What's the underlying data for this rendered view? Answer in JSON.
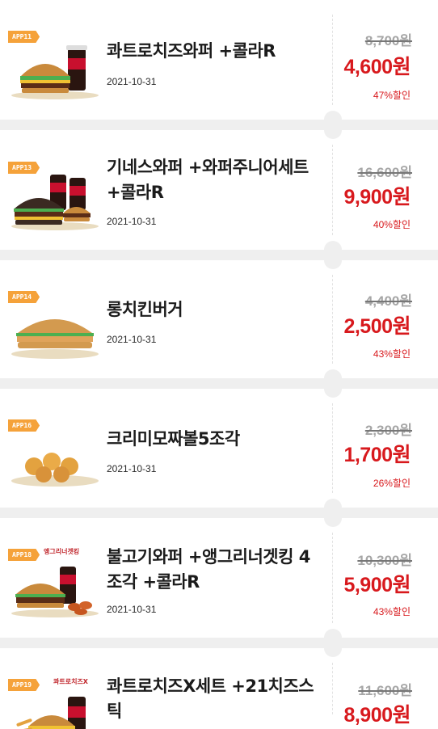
{
  "coupons": [
    {
      "badge": "APP11",
      "badge_tag": "",
      "title": "콰트로치즈와퍼 +콜라R",
      "date": "2021-10-31",
      "original_price": "8,700원",
      "price": "4,600원",
      "discount": "47%할인",
      "image": "burger-set-with-cola"
    },
    {
      "badge": "APP13",
      "badge_tag": "",
      "title": "기네스와퍼 +와퍼주니어세트 +콜라R",
      "date": "2021-10-31",
      "original_price": "16,600원",
      "price": "9,900원",
      "discount": "40%할인",
      "image": "double-burger-set"
    },
    {
      "badge": "APP14",
      "badge_tag": "",
      "title": "롱치킨버거",
      "date": "2021-10-31",
      "original_price": "4,400원",
      "price": "2,500원",
      "discount": "43%할인",
      "image": "long-chicken-burger"
    },
    {
      "badge": "APP16",
      "badge_tag": "",
      "title": "크리미모짜볼5조각",
      "date": "2021-10-31",
      "original_price": "2,300원",
      "price": "1,700원",
      "discount": "26%할인",
      "image": "mozza-balls"
    },
    {
      "badge": "APP18",
      "badge_tag": "앵그리너겟킹",
      "title": "불고기와퍼 +앵그리너겟킹 4조각 +콜라R",
      "date": "2021-10-31",
      "original_price": "10,300원",
      "price": "5,900원",
      "discount": "43%할인",
      "image": "burger-nuggets-cola"
    },
    {
      "badge": "APP19",
      "badge_tag": "콰트로치즈X",
      "title": "콰트로치즈X세트 +21치즈스틱",
      "date": "",
      "original_price": "11,600원",
      "price": "8,900원",
      "discount": "",
      "image": "cheese-set-with-sticks"
    }
  ],
  "colors": {
    "accent_red": "#d8191d",
    "badge_orange": "#f5a23a",
    "background": "#efefef"
  }
}
